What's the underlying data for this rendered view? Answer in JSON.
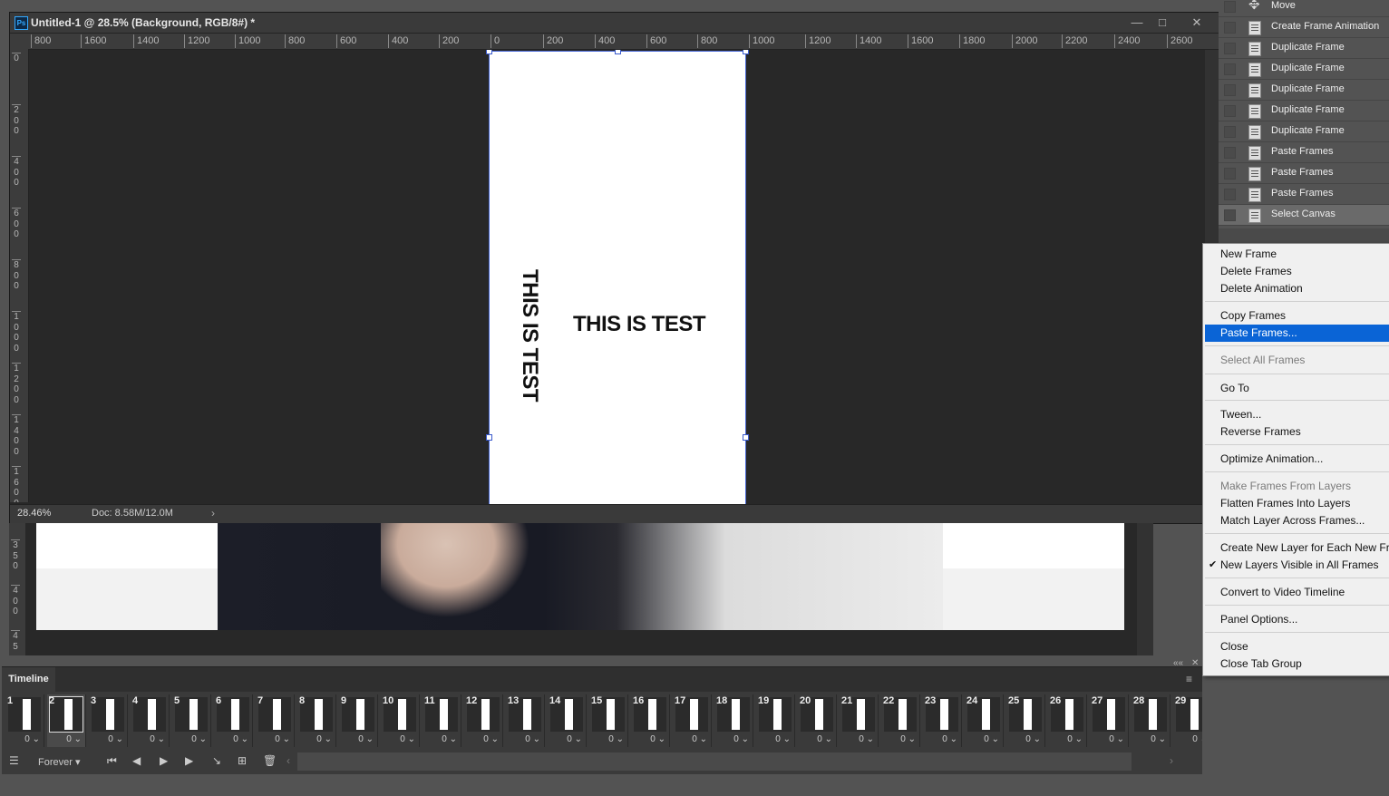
{
  "document": {
    "title": "Untitled-1 @ 28.5% (Background, RGB/8#) *",
    "app_icon": "Ps",
    "window_buttons": {
      "minimize": "—",
      "restore": "□",
      "close": "✕"
    },
    "ruler_h": [
      "800",
      "1600",
      "1400",
      "1200",
      "1000",
      "800",
      "600",
      "400",
      "200",
      "0",
      "200",
      "400",
      "600",
      "800",
      "1000",
      "1200",
      "1400",
      "1600",
      "1800",
      "2000",
      "2200",
      "2400",
      "2600"
    ],
    "ruler_v": [
      "0",
      "200",
      "400",
      "600",
      "800",
      "1000",
      "1200",
      "1400",
      "1600"
    ],
    "canvas_text_rotated": "THIS IS TEST",
    "canvas_text": "THIS IS TEST",
    "zoom": "28.46%",
    "doc_size": "Doc: 8.58M/12.0M",
    "status_arrow": "›"
  },
  "second_doc": {
    "ruler_v": [
      "350",
      "400",
      "45"
    ]
  },
  "history": {
    "items": [
      {
        "label": "Move",
        "icon": "move-icon"
      },
      {
        "label": "Create Frame Animation",
        "icon": "history-state-icon"
      },
      {
        "label": "Duplicate Frame",
        "icon": "history-state-icon"
      },
      {
        "label": "Duplicate Frame",
        "icon": "history-state-icon"
      },
      {
        "label": "Duplicate Frame",
        "icon": "history-state-icon"
      },
      {
        "label": "Duplicate Frame",
        "icon": "history-state-icon"
      },
      {
        "label": "Duplicate Frame",
        "icon": "history-state-icon"
      },
      {
        "label": "Paste Frames",
        "icon": "history-state-icon"
      },
      {
        "label": "Paste Frames",
        "icon": "history-state-icon"
      },
      {
        "label": "Paste Frames",
        "icon": "history-state-icon"
      },
      {
        "label": "Select Canvas",
        "icon": "history-state-icon",
        "selected": true
      }
    ]
  },
  "context_menu": {
    "items": [
      {
        "label": "New Frame"
      },
      {
        "label": "Delete Frames"
      },
      {
        "label": "Delete Animation"
      },
      {
        "label": "Copy Frames"
      },
      {
        "label": "Paste Frames...",
        "highlighted": true
      },
      {
        "label": "Select All Frames",
        "disabled": true
      },
      {
        "label": "Go To"
      },
      {
        "label": "Tween..."
      },
      {
        "label": "Reverse Frames"
      },
      {
        "label": "Optimize Animation..."
      },
      {
        "label": "Make Frames From Layers",
        "disabled": true
      },
      {
        "label": "Flatten Frames Into Layers"
      },
      {
        "label": "Match Layer Across Frames..."
      },
      {
        "label": "Create New Layer for Each New Frame"
      },
      {
        "label": "New Layers Visible in All Frames",
        "checked": true
      },
      {
        "label": "Convert to Video Timeline"
      },
      {
        "label": "Panel Options..."
      },
      {
        "label": "Close"
      },
      {
        "label": "Close Tab Group"
      }
    ],
    "check_mark": "✔"
  },
  "timeline": {
    "tab": "Timeline",
    "selected_frame": 2,
    "frames": [
      "1",
      "2",
      "3",
      "4",
      "5",
      "6",
      "7",
      "8",
      "9",
      "10",
      "11",
      "12",
      "13",
      "14",
      "15",
      "16",
      "17",
      "18",
      "19",
      "20",
      "21",
      "22",
      "23",
      "24",
      "25",
      "26",
      "27",
      "28",
      "29"
    ],
    "frame_delay": "0",
    "loop": "Forever",
    "menu_icon": "≡",
    "collapse_icon": "««",
    "close_icon": "✕",
    "scroll_left": "‹",
    "scroll_right": "›"
  },
  "colors": {
    "highlight": "#0a64d6",
    "canvas_bg": "#282828",
    "panel_bg": "#535353",
    "selection_border": "#4a6ad8"
  }
}
